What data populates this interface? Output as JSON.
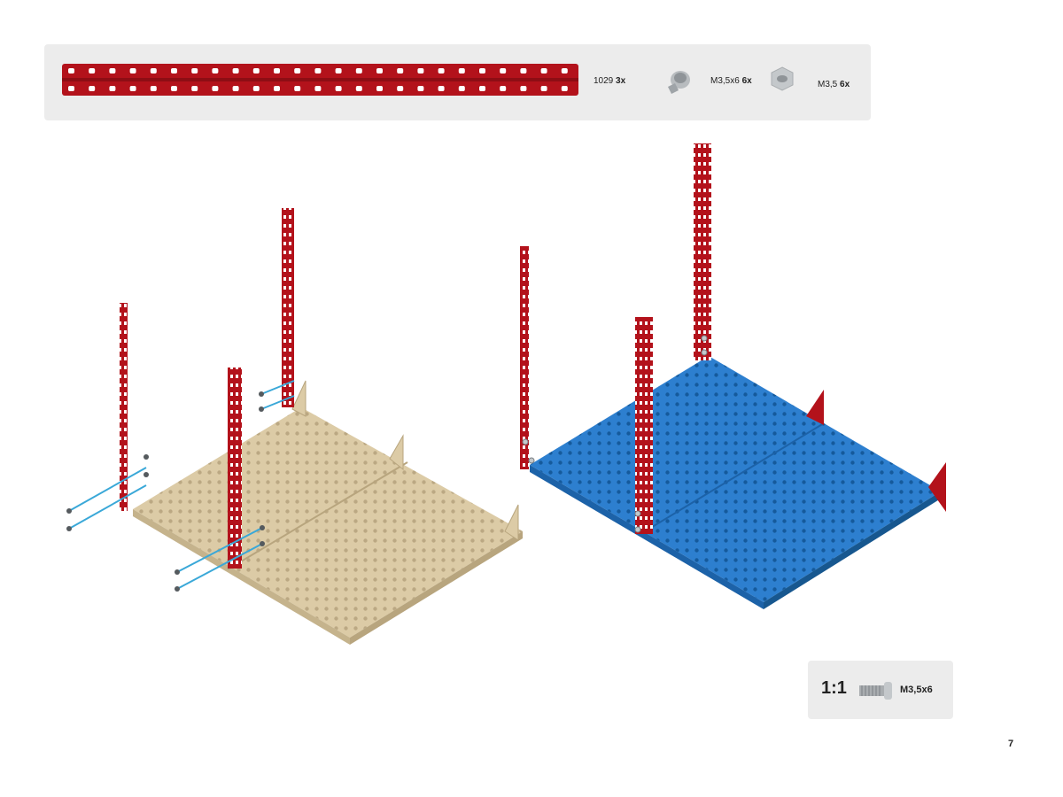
{
  "parts": [
    {
      "name": "1029",
      "qty": "3x"
    },
    {
      "name": "M3,5x6",
      "qty": "6x"
    },
    {
      "name": "M3,5",
      "qty": "6x"
    }
  ],
  "scale": {
    "ratio": "1:1",
    "label": "M3,5x6"
  },
  "page_number": "7",
  "colors": {
    "strip": "#b3121b",
    "plate_raw": "#d9c8a3",
    "plate_finished": "#2277c9",
    "screw_line": "#3aa8d8",
    "panel_bg": "#ececec"
  },
  "icons": [
    "metal-strip-icon",
    "screw-icon",
    "nut-icon",
    "screw-scale-icon"
  ]
}
